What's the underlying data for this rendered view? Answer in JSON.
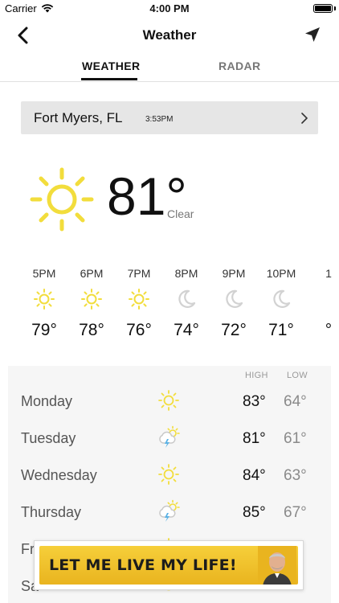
{
  "status_bar": {
    "carrier": "Carrier",
    "time": "4:00 PM"
  },
  "nav": {
    "title": "Weather"
  },
  "tabs": [
    {
      "label": "WEATHER",
      "active": true
    },
    {
      "label": "RADAR",
      "active": false
    }
  ],
  "location": {
    "name": "Fort Myers, FL",
    "updated": "3:53PM"
  },
  "current": {
    "temp": "81°",
    "condition": "Clear",
    "icon": "sun-icon",
    "icon_color": "#f2dd3c"
  },
  "hourly": [
    {
      "label": "5PM",
      "icon": "sun-icon",
      "temp": "79°"
    },
    {
      "label": "6PM",
      "icon": "sun-icon",
      "temp": "78°"
    },
    {
      "label": "7PM",
      "icon": "sun-icon",
      "temp": "76°"
    },
    {
      "label": "8PM",
      "icon": "moon-icon",
      "temp": "74°"
    },
    {
      "label": "9PM",
      "icon": "moon-icon",
      "temp": "72°"
    },
    {
      "label": "10PM",
      "icon": "moon-icon",
      "temp": "71°"
    },
    {
      "label": "1",
      "icon": "",
      "temp": "°"
    }
  ],
  "daily": {
    "high_header": "HIGH",
    "low_header": "LOW",
    "days": [
      {
        "name": "Monday",
        "icon": "sun-icon",
        "high": "83°",
        "low": "64°"
      },
      {
        "name": "Tuesday",
        "icon": "thunderstorm-icon",
        "high": "81°",
        "low": "61°"
      },
      {
        "name": "Wednesday",
        "icon": "sun-icon",
        "high": "84°",
        "low": "63°"
      },
      {
        "name": "Thursday",
        "icon": "thunderstorm-icon",
        "high": "85°",
        "low": "67°"
      },
      {
        "name": "Fri",
        "icon": "sun-icon",
        "high": "",
        "low": ""
      },
      {
        "name": "Sa",
        "icon": "sun-icon",
        "high": "",
        "low": ""
      }
    ]
  },
  "ad": {
    "text": "LET ME LIVE MY LIFE!"
  }
}
